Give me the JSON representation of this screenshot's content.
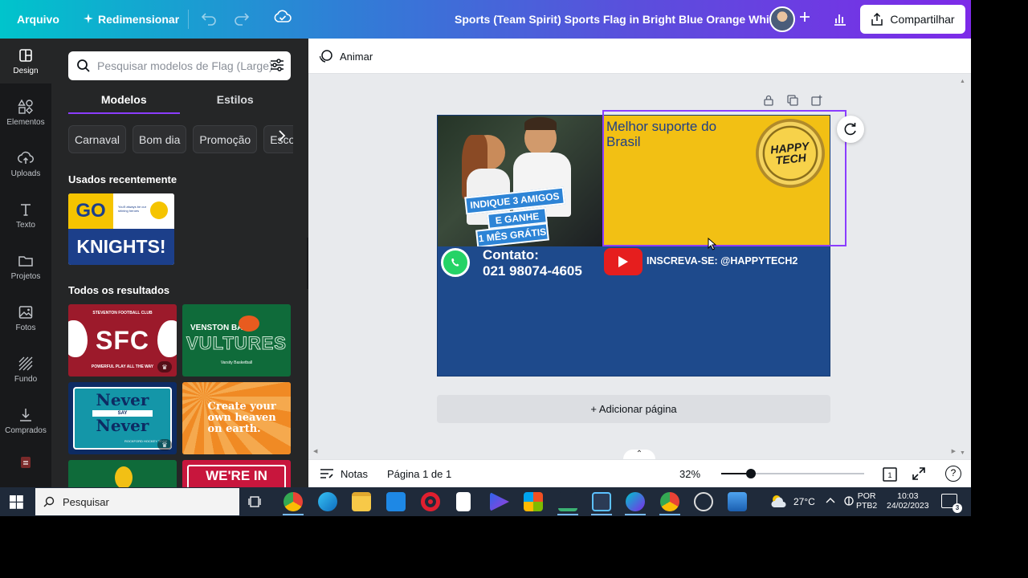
{
  "topbar": {
    "file_label": "Arquivo",
    "resize_label": "Redimensionar",
    "doc_title": "Sports (Team Spirit) Sports Flag in Bright Blue Orange Whit...",
    "share_label": "Compartilhar",
    "gradient_start": "#00c4cc",
    "gradient_end": "#7d2ae8"
  },
  "rail": {
    "items": [
      {
        "label": "Design",
        "icon": "layout-icon"
      },
      {
        "label": "Elementos",
        "icon": "shapes-icon"
      },
      {
        "label": "Uploads",
        "icon": "cloud-upload-icon"
      },
      {
        "label": "Texto",
        "icon": "text-icon"
      },
      {
        "label": "Projetos",
        "icon": "folder-icon"
      },
      {
        "label": "Fotos",
        "icon": "image-icon"
      },
      {
        "label": "Fundo",
        "icon": "pattern-icon"
      },
      {
        "label": "Comprados",
        "icon": "download-icon"
      }
    ]
  },
  "panel": {
    "search_placeholder": "Pesquisar modelos de Flag (Large)",
    "tabs": [
      "Modelos",
      "Estilos"
    ],
    "chips": [
      "Carnaval",
      "Bom dia",
      "Promoção",
      "Escola"
    ],
    "recent_title": "Usados recentemente",
    "recent_thumb": {
      "top": "GO",
      "bottom": "KNIGHTS!",
      "small": "You'll always be our shining heroes"
    },
    "results_title": "Todos os resultados",
    "results": [
      {
        "title": "SFC",
        "sub_top": "STEVENTON FOOTBALL CLUB",
        "sub_bottom": "POWERFUL PLAY ALL THE WAY"
      },
      {
        "title": "VULTURES",
        "sub_top": "VENSTON BAY",
        "sub_bottom": "Varsity Basketball"
      },
      {
        "title": "Never",
        "mid": "SAY",
        "title2": "Never",
        "sub_bottom": "ROCKFORD HOCKEY TEAM"
      },
      {
        "title": "Create your own heaven on earth."
      },
      {
        "title": ""
      },
      {
        "title": "WE'RE IN"
      }
    ]
  },
  "editor": {
    "animate_label": "Animar",
    "add_page_label": "+ Adicionar página",
    "design": {
      "banner_lines": [
        "INDIQUE 3 AMIGOS",
        "E GANHE",
        "1 MÊS GRÁTIS"
      ],
      "support_text": "Melhor suporte do Brasil",
      "badge_text": "HAPPY TECH",
      "contact_label": "Contato:",
      "contact_phone": "021 98074-4605",
      "subscribe_text": "INSCREVA-SE: @HAPPYTECH2",
      "bg_color": "#1e4a8c",
      "yellow_color": "#f2c014"
    }
  },
  "bottombar": {
    "notes_label": "Notas",
    "page_label": "Página 1 de 1",
    "zoom_label": "32%",
    "zoom_value": 32,
    "page_count": "1",
    "help_label": "?"
  },
  "taskbar": {
    "search_label": "Pesquisar",
    "temperature": "27°C",
    "lang_top": "POR",
    "lang_bottom": "PTB2",
    "time": "10:03",
    "date": "24/02/2023",
    "notification_count": "3"
  }
}
